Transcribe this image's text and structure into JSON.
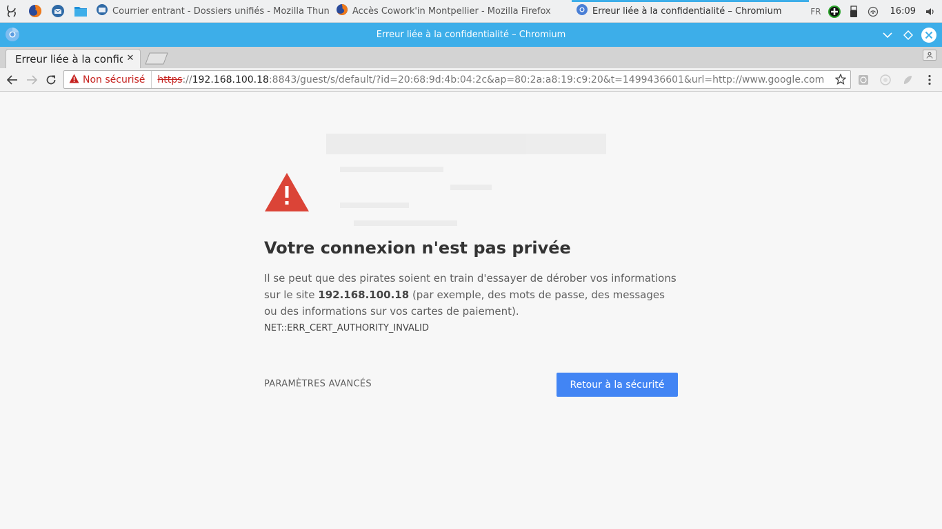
{
  "taskbar": {
    "launcher_icon": "kde-launcher-icon",
    "pinned_apps": [
      "firefox-icon",
      "thunderbird-icon",
      "file-manager-icon"
    ],
    "tasks": [
      {
        "icon": "thunderbird-icon",
        "label": "Courrier entrant - Dossiers unifiés - Mozilla Thun"
      },
      {
        "icon": "firefox-icon",
        "label": "Accès Cowork'in Montpellier - Mozilla Firefox"
      },
      {
        "icon": "chromium-icon",
        "label": "Erreur liée à la confidentialité – Chromium"
      }
    ],
    "tray": {
      "lang": "FR",
      "clock": "16:09",
      "icons": [
        "add-icon",
        "usb-icon",
        "network-icon",
        "volume-icon"
      ]
    }
  },
  "window": {
    "title": "Erreur liée à la confidentialité – Chromium"
  },
  "browser": {
    "tab_title": "Erreur liée à la confidentialité",
    "omnibox": {
      "security_label": "Non sécurisé",
      "url_scheme": "https",
      "url_separator": "://",
      "url_host": "192.168.100.18",
      "url_rest": ":8843/guest/s/default/?id=20:68:9d:4b:04:2c&ap=80:2a:a8:19:c9:20&t=1499436601&url=http://www.google.com"
    }
  },
  "page": {
    "heading": "Votre connexion n'est pas privée",
    "body_pre": "Il se peut que des pirates soient en train d'essayer de dérober vos informations sur le site ",
    "body_host": "192.168.100.18",
    "body_post": " (par exemple, des mots de passe, des messages ou des informations sur vos cartes de paiement).",
    "error_code": "NET::ERR_CERT_AUTHORITY_INVALID",
    "advanced_label": "PARAMÈTRES AVANCÉS",
    "back_button_label": "Retour à la sécurité"
  },
  "colors": {
    "titlebar": "#3daee9",
    "warning_red": "#db4437",
    "primary_button": "#4285f4",
    "insecure_red": "#c5221f"
  }
}
